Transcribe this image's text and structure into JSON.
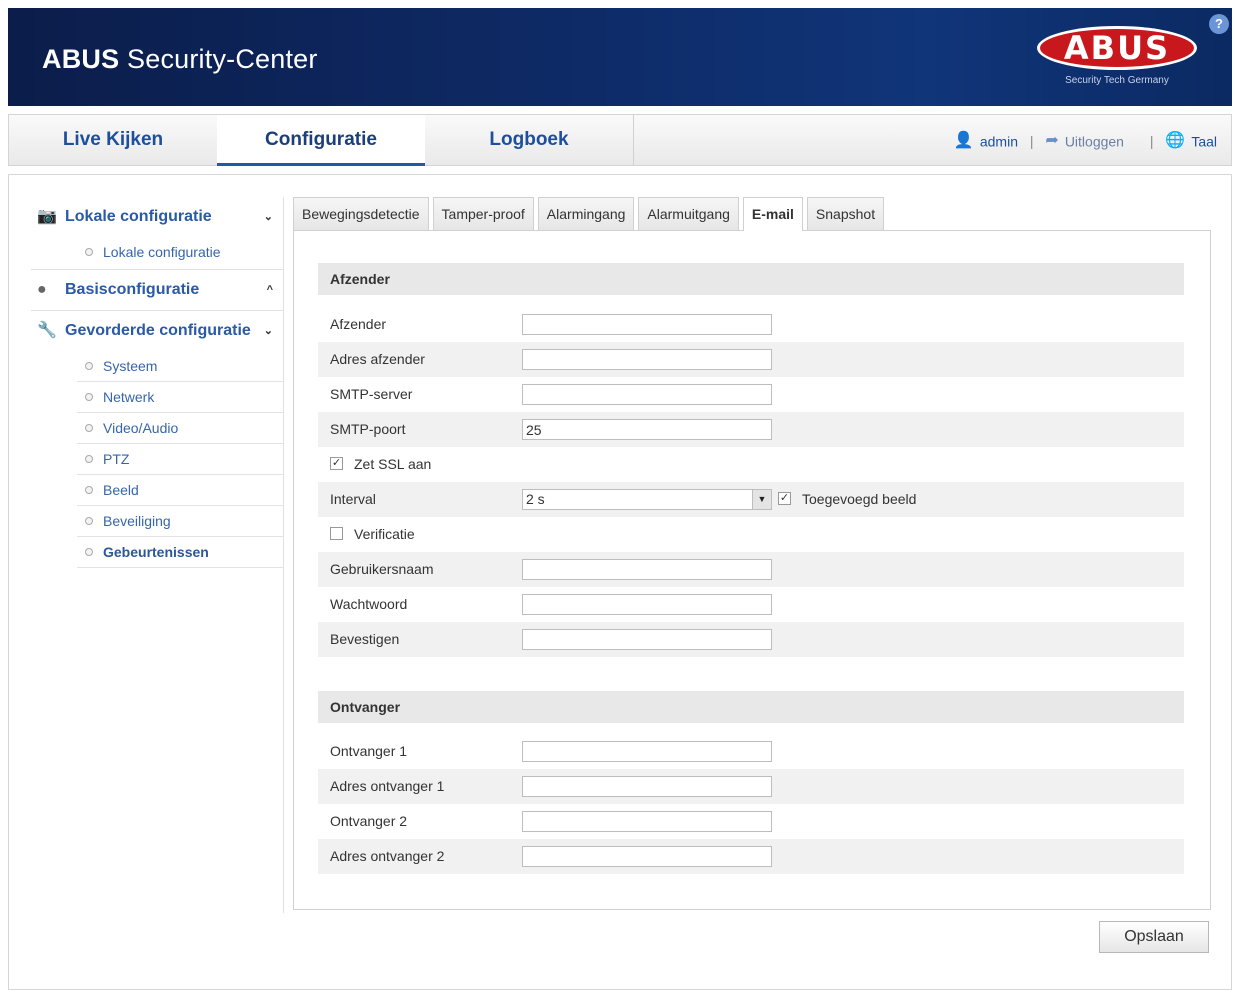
{
  "header": {
    "brand_bold": "ABUS",
    "app_title_rest": " Security-Center",
    "logo_text": "ABUS",
    "logo_tagline": "Security Tech Germany",
    "help_symbol": "?"
  },
  "topnav": {
    "tabs": [
      {
        "label": "Live Kijken"
      },
      {
        "label": "Configuratie",
        "active": true
      },
      {
        "label": "Logboek"
      }
    ],
    "user": "admin",
    "logout": "Uitloggen",
    "language": "Taal"
  },
  "sidebar": {
    "groups": [
      {
        "label": "Lokale configuratie",
        "icon": "camera-icon",
        "chevron": "⌄"
      },
      {
        "label": "Basisconfiguratie",
        "icon": "globe-icon",
        "chevron": "^"
      },
      {
        "label": "Gevorderde configuratie",
        "icon": "wrench-icon",
        "chevron": "⌄"
      }
    ],
    "local_items": [
      {
        "label": "Lokale configuratie"
      }
    ],
    "advanced_items": [
      {
        "label": "Systeem"
      },
      {
        "label": "Netwerk"
      },
      {
        "label": "Video/Audio"
      },
      {
        "label": "PTZ"
      },
      {
        "label": "Beeld"
      },
      {
        "label": "Beveiliging"
      },
      {
        "label": "Gebeurtenissen",
        "active": true
      }
    ]
  },
  "tabs": [
    {
      "label": "Bewegingsdetectie"
    },
    {
      "label": "Tamper-proof"
    },
    {
      "label": "Alarmingang"
    },
    {
      "label": "Alarmuitgang"
    },
    {
      "label": "E-mail",
      "active": true
    },
    {
      "label": "Snapshot"
    }
  ],
  "sender": {
    "section_title": "Afzender",
    "fields": [
      {
        "label": "Afzender",
        "value": ""
      },
      {
        "label": "Adres afzender",
        "value": ""
      },
      {
        "label": "SMTP-server",
        "value": ""
      },
      {
        "label": "SMTP-poort",
        "value": "25"
      }
    ],
    "ssl": {
      "label": "Zet SSL aan",
      "checked": true
    },
    "interval": {
      "label": "Interval",
      "value": "2 s"
    },
    "attached_image": {
      "label": "Toegevoegd beeld",
      "checked": true
    },
    "verification": {
      "label": "Verificatie",
      "checked": false
    },
    "auth_fields": [
      {
        "label": "Gebruikersnaam",
        "value": ""
      },
      {
        "label": "Wachtwoord",
        "value": ""
      },
      {
        "label": "Bevestigen",
        "value": ""
      }
    ]
  },
  "receiver": {
    "section_title": "Ontvanger",
    "fields": [
      {
        "label": "Ontvanger 1",
        "value": ""
      },
      {
        "label": "Adres ontvanger 1",
        "value": ""
      },
      {
        "label": "Ontvanger 2",
        "value": ""
      },
      {
        "label": "Adres ontvanger 2",
        "value": ""
      }
    ]
  },
  "save_label": "Opslaan",
  "colors": {
    "header_bg": "#0e2a66",
    "logo_red": "#c9171e",
    "link_blue": "#1d4f9c"
  }
}
